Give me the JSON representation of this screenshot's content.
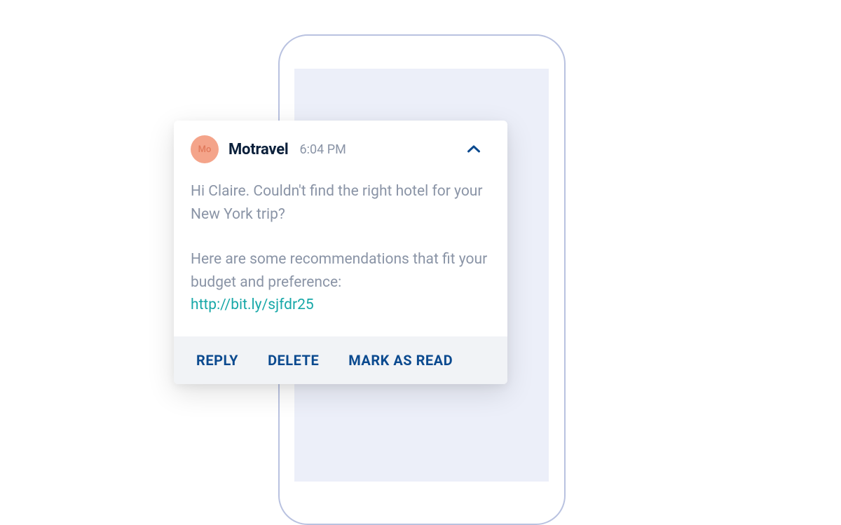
{
  "notification": {
    "avatar_initials": "Mo",
    "sender_name": "Motravel",
    "timestamp": "6:04 PM",
    "body_line1": "Hi Claire. Couldn't find the right hotel for your New York trip?",
    "body_line2": "Here are some recommendations that fit your budget and preference:",
    "link_text": "http://bit.ly/sjfdr25",
    "actions": {
      "reply": "REPLY",
      "delete": "DELETE",
      "mark_read": "MARK AS READ"
    }
  }
}
